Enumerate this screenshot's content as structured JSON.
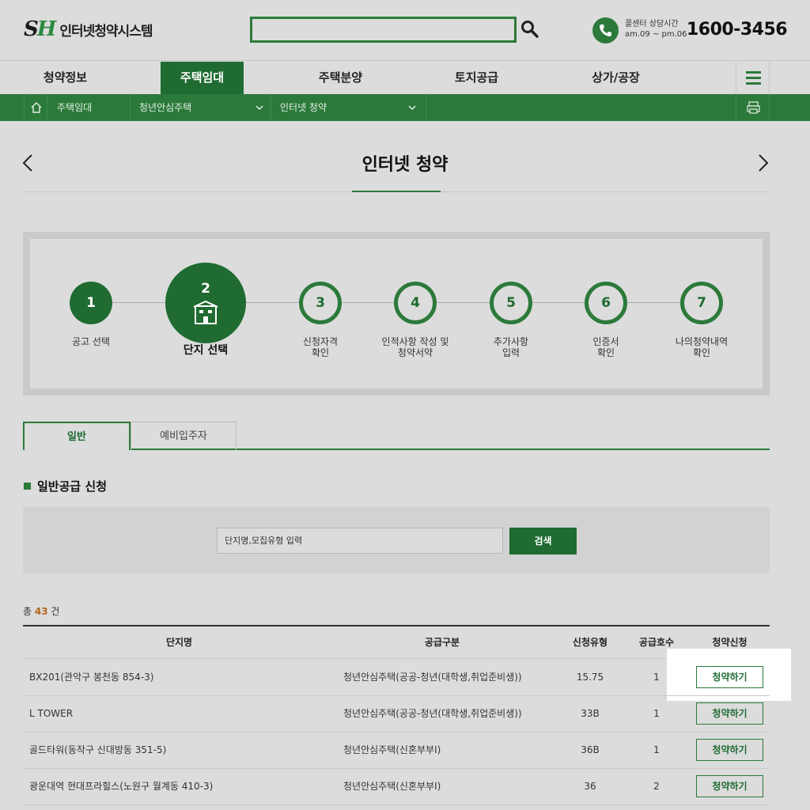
{
  "header": {
    "logo_mark_s": "S",
    "logo_mark_h": "H",
    "logo_text": "인터넷청약시스템",
    "search_value": "",
    "call_label": "콜센터 상담시간",
    "call_hours": "am.09 ~ pm.06",
    "call_number": "1600-3456"
  },
  "gnb": {
    "items": [
      "청약정보",
      "주택임대",
      "주택분양",
      "토지공급",
      "상가/공장"
    ],
    "active_index": 1
  },
  "location": {
    "seg1": "주택임대",
    "seg2": "청년안심주택",
    "seg3": "인터넷 청약"
  },
  "page_title": "인터넷 청약",
  "steps": [
    {
      "num": "1",
      "label": "공고 선택"
    },
    {
      "num": "2",
      "label": "단지 선택"
    },
    {
      "num": "3",
      "label": "신청자격\n확인"
    },
    {
      "num": "4",
      "label": "인적사항 작성 및\n청약서약"
    },
    {
      "num": "5",
      "label": "추가사항\n입력"
    },
    {
      "num": "6",
      "label": "인증서\n확인"
    },
    {
      "num": "7",
      "label": "나의청약내역\n확인"
    }
  ],
  "tabs": [
    "일반",
    "예비입주자"
  ],
  "section_title": "일반공급 신청",
  "filter": {
    "value": "단지명,모집유형 입력",
    "button": "검색"
  },
  "total": {
    "prefix": "총",
    "count": "43",
    "suffix": "건"
  },
  "table": {
    "headers": [
      "단지명",
      "공급구분",
      "신청유형",
      "공급호수",
      "청약신청"
    ],
    "rows": [
      {
        "name": "BX201(관악구 봉천동 854-3)",
        "type": "청년안심주택(공공-청년(대학생,취업준비생))",
        "apply_type": "15.75",
        "units": "1",
        "action": "청약하기"
      },
      {
        "name": "L TOWER",
        "type": "청년안심주택(공공-청년(대학생,취업준비생))",
        "apply_type": "33B",
        "units": "1",
        "action": "청약하기"
      },
      {
        "name": "골드타워(동작구 신대방동 351-5)",
        "type": "청년안심주택(신혼부부Ⅰ)",
        "apply_type": "36B",
        "units": "1",
        "action": "청약하기"
      },
      {
        "name": "광운대역 현대프라힐스(노원구 월계동 410-3)",
        "type": "청년안심주택(신혼부부Ⅰ)",
        "apply_type": "36",
        "units": "2",
        "action": "청약하기"
      }
    ]
  },
  "colors": {
    "primary": "#2c7a3a",
    "primary_dark": "#1f6b31",
    "count_accent": "#b5651d"
  }
}
